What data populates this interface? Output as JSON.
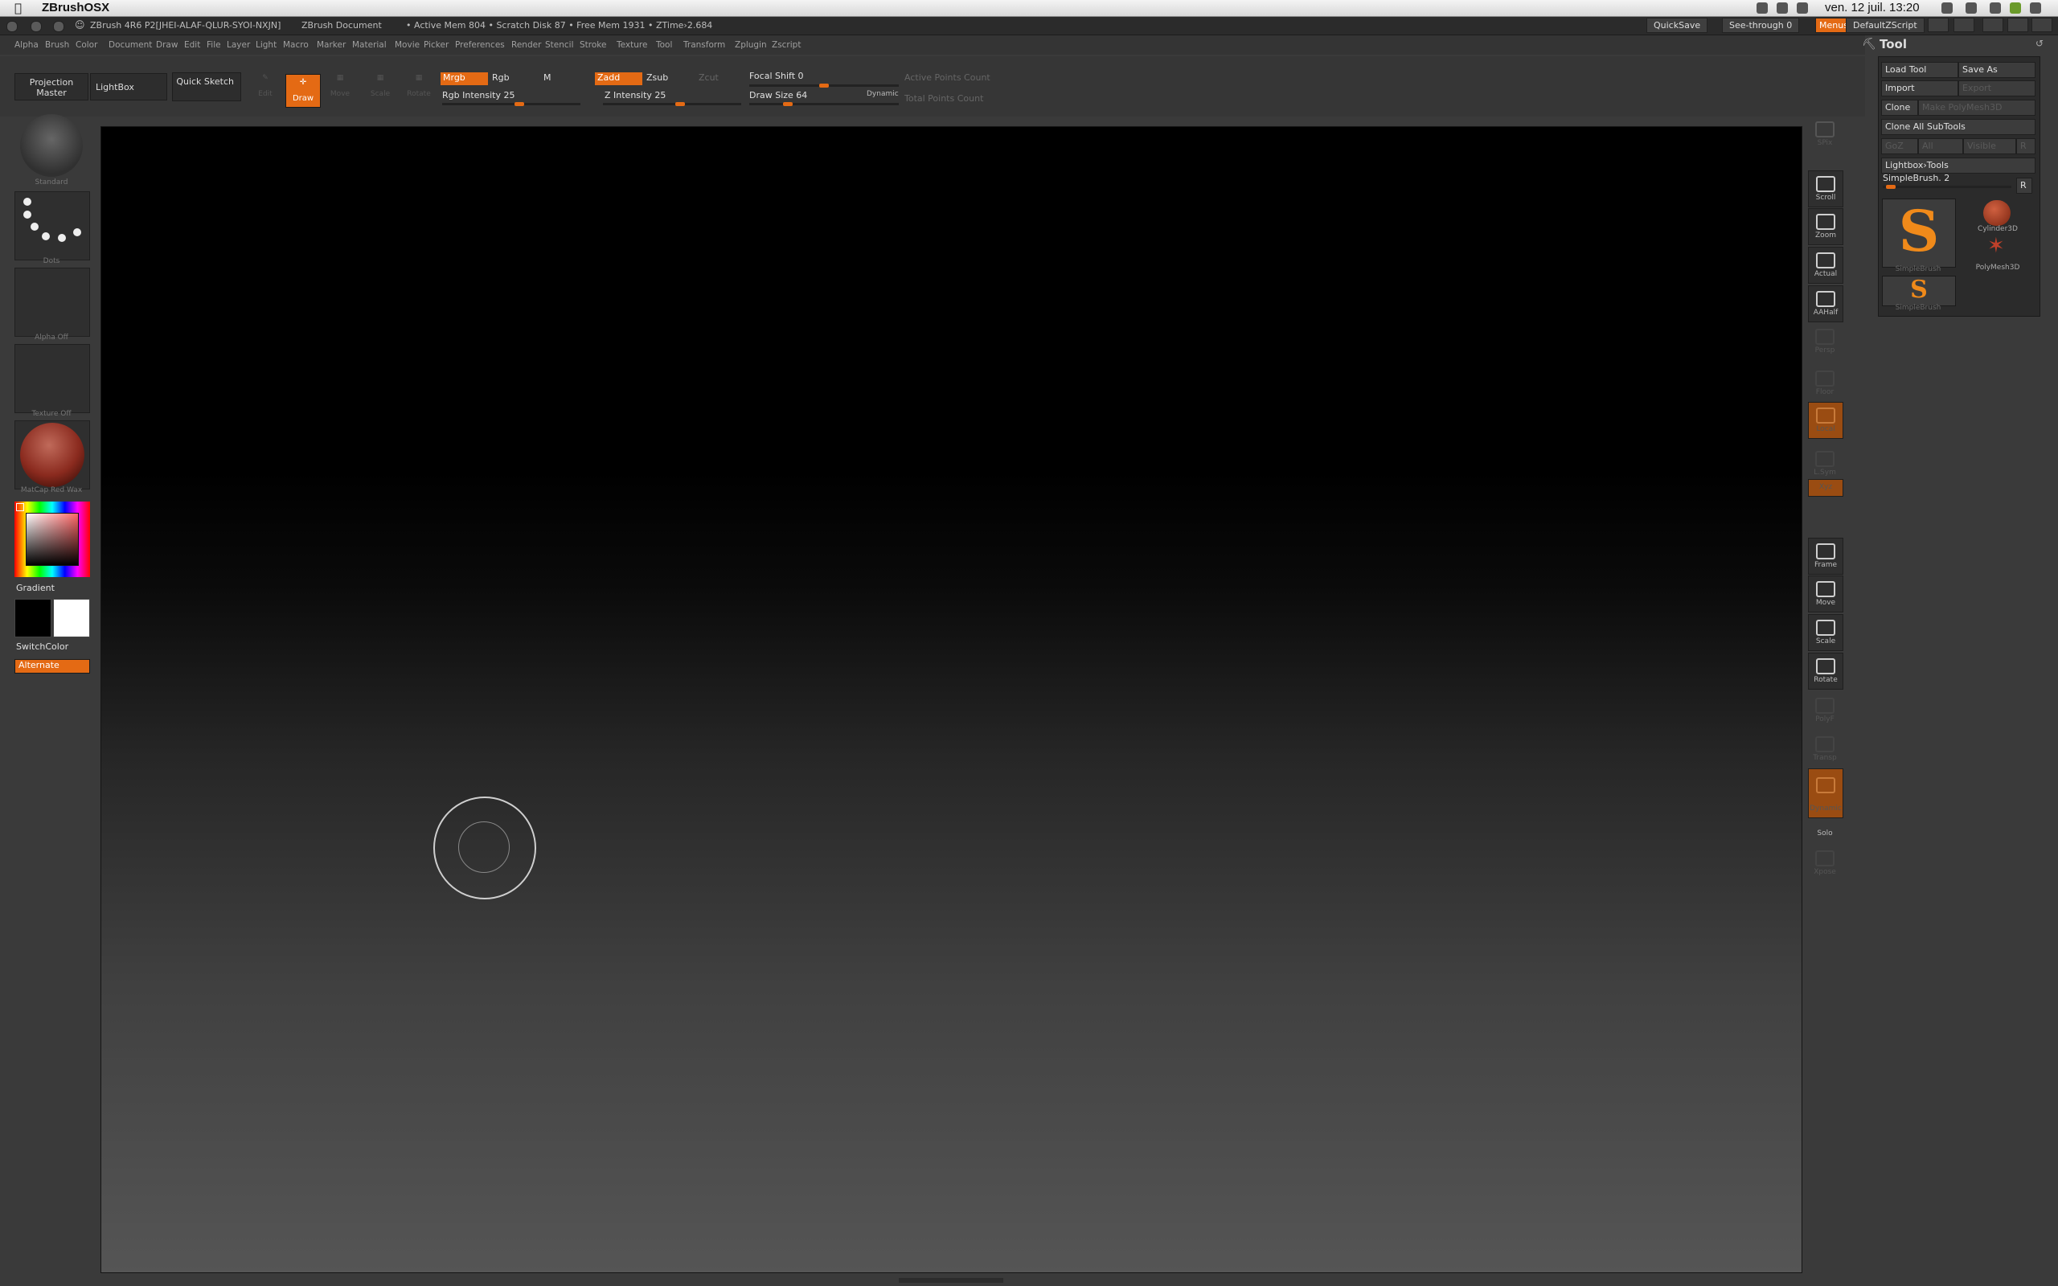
{
  "macbar": {
    "app_name": "ZBrushOSX",
    "clock": "ven. 12 juil.  13:20"
  },
  "titlebar": {
    "version": "ZBrush 4R6 P2[JHEI-ALAF-QLUR-SYOI-NXJN]",
    "document": "ZBrush Document",
    "stats": "• Active Mem 804 • Scratch Disk 87 • Free Mem 1931 • ZTime›2.684",
    "quicksave": "QuickSave",
    "see_through": "See-through  0",
    "menus": "Menus",
    "default_script": "DefaultZScript"
  },
  "menus": [
    "Alpha",
    "Brush",
    "Color",
    "Document",
    "Draw",
    "Edit",
    "File",
    "Layer",
    "Light",
    "Macro",
    "Marker",
    "Material",
    "Movie",
    "Picker",
    "Preferences",
    "Render",
    "Stencil",
    "Stroke",
    "Texture",
    "Tool",
    "Transform",
    "Zplugin",
    "Zscript"
  ],
  "shelf": {
    "projection_master": "Projection Master",
    "lightbox": "LightBox",
    "quick_sketch": "Quick Sketch",
    "edit": "Edit",
    "draw": "Draw",
    "move": "Move",
    "scale": "Scale",
    "rotate": "Rotate",
    "mrgb": "Mrgb",
    "rgb": "Rgb",
    "m": "M",
    "zadd": "Zadd",
    "zsub": "Zsub",
    "zcut": "Zcut",
    "rgb_intensity": "Rgb Intensity 25",
    "z_intensity": "Z Intensity 25",
    "focal_shift": "Focal Shift 0",
    "draw_size": "Draw Size 64",
    "dynamic": "Dynamic",
    "active_points": "Active Points Count",
    "total_points": "Total Points Count",
    "rgb_intensity_value": 25,
    "z_intensity_value": 25,
    "draw_size_value": 64
  },
  "left_tray": {
    "brush_label": "Standard",
    "stroke_label": "Dots",
    "alpha_label": "Alpha Off",
    "texture_label": "Texture Off",
    "material_label": "MatCap Red Wax",
    "gradient": "Gradient",
    "switch_color": "SwitchColor",
    "alternate": "Alternate"
  },
  "right_toolbar": [
    "SPix",
    "Scroll",
    "Zoom",
    "Actual",
    "AAHalf",
    "Persp",
    "Floor",
    "Local",
    "L.Sym",
    "Xyz",
    "Frame",
    "Move",
    "Scale",
    "Rotate",
    "PolyF",
    "Transp",
    "Dynamic",
    "Solo",
    "Xpose"
  ],
  "tool_palette": {
    "title": "Tool",
    "load_tool": "Load Tool",
    "save_as": "Save As",
    "import": "Import",
    "export": "Export",
    "clone": "Clone",
    "make_polymesh": "Make PolyMesh3D",
    "clone_all": "Clone All SubTools",
    "goz": "GoZ",
    "all": "All",
    "visible": "Visible",
    "r1": "R",
    "lightbox_tools": "Lightbox›Tools",
    "current_tool": "SimpleBrush. 2",
    "r2": "R",
    "tools": [
      {
        "name": "SimpleBrush"
      },
      {
        "name": "Cylinder3D"
      },
      {
        "name": "PolyMesh3D"
      },
      {
        "name": "SimpleBrush"
      }
    ]
  }
}
